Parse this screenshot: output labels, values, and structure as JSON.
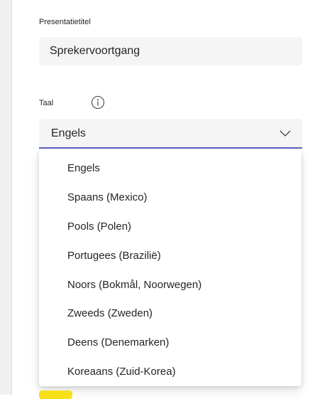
{
  "form": {
    "presentation_title_label": "Presentatietitel",
    "presentation_title_value": "Sprekervoortgang",
    "language_label": "Taal",
    "language_selected": "Engels"
  },
  "dropdown": {
    "options": [
      "Engels",
      "Spaans (Mexico)",
      "Pools (Polen)",
      "Portugees (Brazilië)",
      "Noors (Bokmål, Noorwegen)",
      "Zweeds (Zweden)",
      "Deens (Denemarken)",
      "Koreaans (Zuid-Korea)"
    ]
  },
  "icons": {
    "info": "info-icon",
    "chevron": "chevron-down-icon"
  },
  "colors": {
    "accent": "#5b5fc7",
    "field_bg": "#f5f5f5",
    "button_yellow": "#f8e019"
  }
}
